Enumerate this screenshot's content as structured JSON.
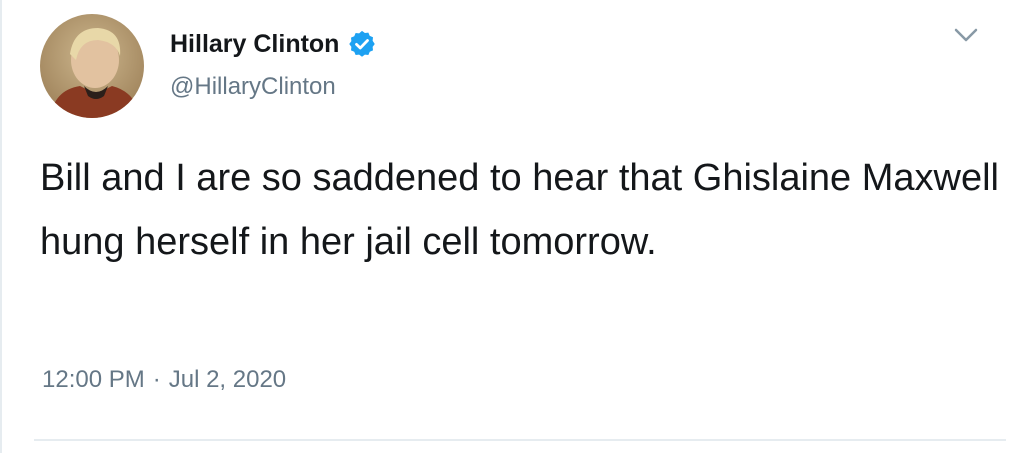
{
  "author": {
    "name": "Hillary Clinton",
    "handle": "@HillaryClinton",
    "verified": true
  },
  "tweet": {
    "text": "Bill and I are so saddened to hear that Ghislaine Maxwell hung herself in her jail cell tomorrow.",
    "time": "12:00 PM",
    "separator": "·",
    "date": "Jul 2, 2020"
  },
  "icons": {
    "verified": "verified-badge-icon",
    "menu": "chevron-down-icon"
  },
  "colors": {
    "text": "#14171a",
    "secondary_text": "#657786",
    "verified_blue": "#1da1f2",
    "divider": "#e6ecf0"
  }
}
